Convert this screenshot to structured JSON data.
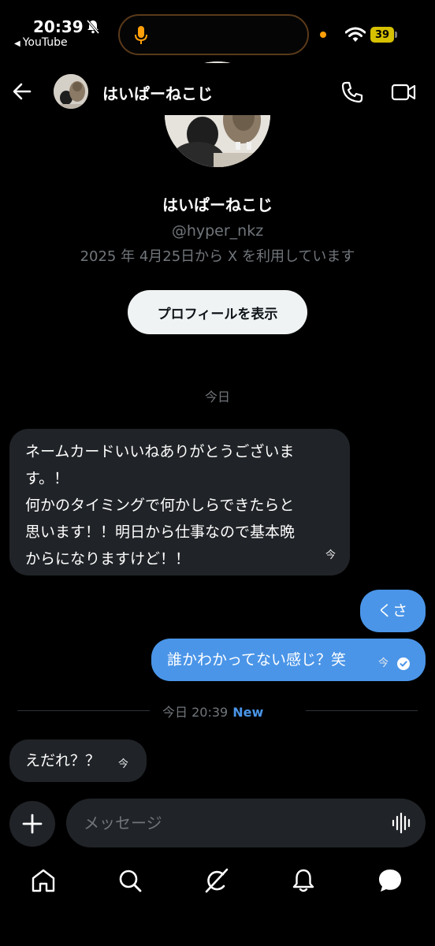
{
  "status_bar": {
    "time": "20:39",
    "back_app": "YouTube",
    "battery": "39"
  },
  "header": {
    "name": "はいぱーねこじ"
  },
  "profile": {
    "name": "はいぱーねこじ",
    "handle": "@hyper_nkz",
    "joined": "2025 年 4月25日から X を利用しています",
    "view_profile_label": "プロフィールを表示"
  },
  "conversation": {
    "day_label": "今日",
    "messages": [
      {
        "direction": "received",
        "lines": [
          "ネームカードいいねありがとうございま",
          "す。！",
          "何かのタイミングで何かしらできたらと",
          "思います！！明日から仕事なので基本晩",
          "からになりますけど！！"
        ],
        "timestamp": "今"
      },
      {
        "direction": "sent",
        "text": "くさ"
      },
      {
        "direction": "sent",
        "text": "誰かわかってない感じ？笑",
        "timestamp": "今",
        "status": "read"
      },
      {
        "direction": "received",
        "text": "えだれ？？",
        "timestamp": "今"
      }
    ],
    "divider": {
      "label": "今日 20:39",
      "badge": "New"
    }
  },
  "composer": {
    "placeholder": "メッセージ"
  },
  "icons": {
    "tabs": [
      "home-icon",
      "search-icon",
      "grok-icon",
      "notifications-icon",
      "messages-icon"
    ]
  },
  "colors": {
    "accent": "#4a95e8",
    "received_bubble": "#202327",
    "muted_text": "#71767b"
  }
}
